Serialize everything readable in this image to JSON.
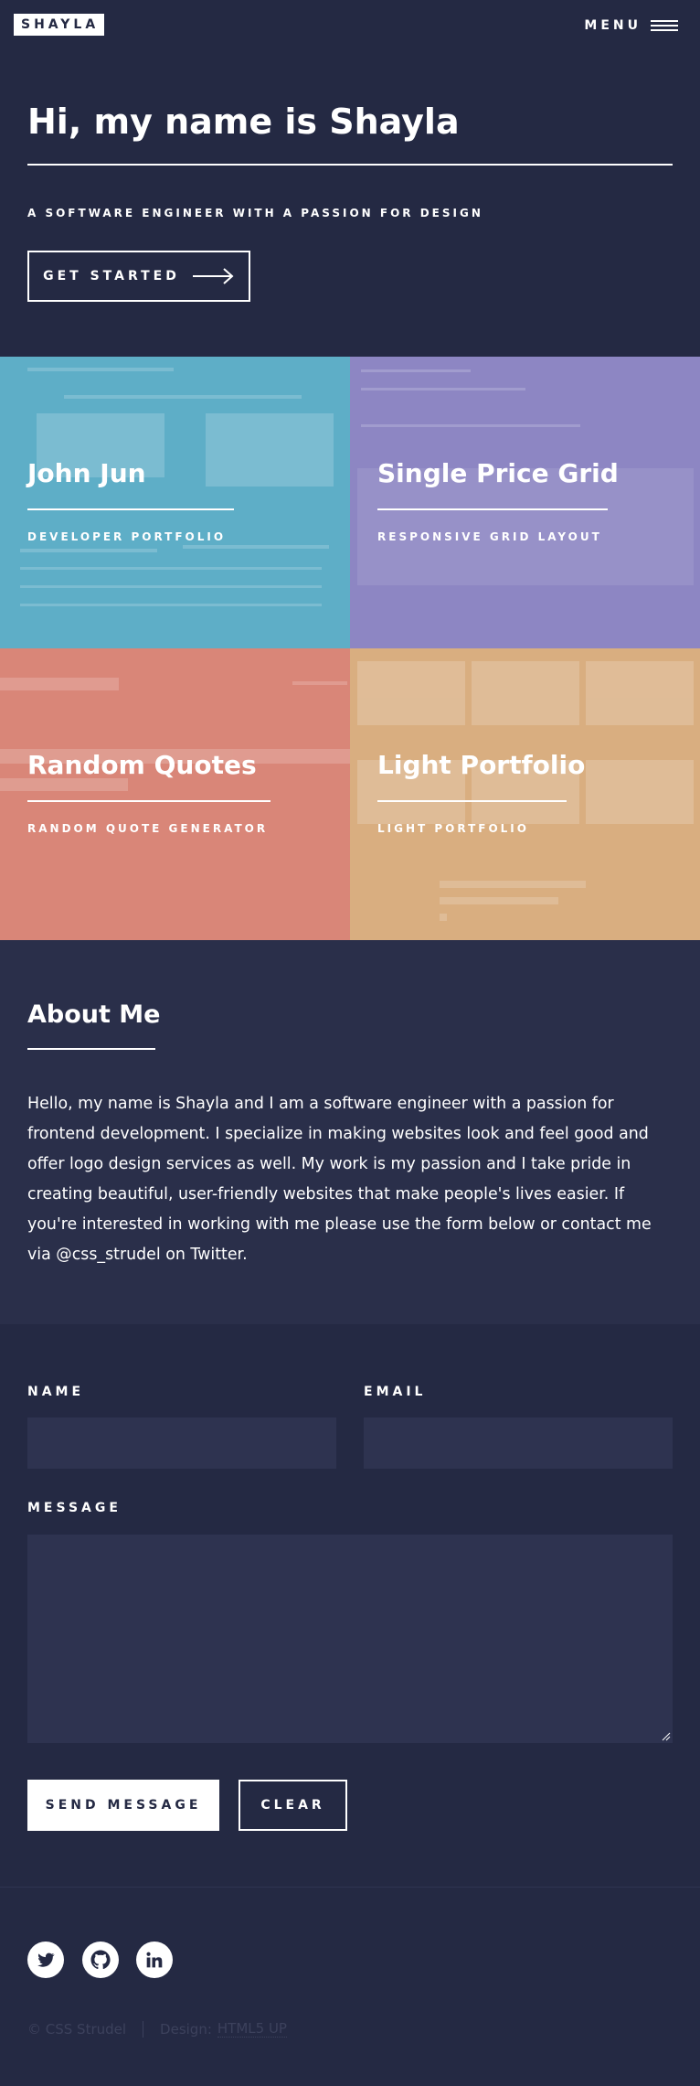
{
  "header": {
    "logo": "SHAYLA",
    "menu_label": "MENU"
  },
  "hero": {
    "title": "Hi, my name is Shayla",
    "subtitle": "A SOFTWARE ENGINEER WITH A PASSION FOR DESIGN",
    "cta_label": "GET STARTED"
  },
  "tiles": [
    {
      "title": "John Jun",
      "subtitle": "DEVELOPER PORTFOLIO",
      "color": "#5eaec7"
    },
    {
      "title": "Single Price Grid",
      "subtitle": "RESPONSIVE GRID LAYOUT",
      "color": "#8d86c3"
    },
    {
      "title": "Random Quotes",
      "subtitle": "RANDOM QUOTE GENERATOR",
      "color": "#d98678"
    },
    {
      "title": "Light Portfolio",
      "subtitle": "LIGHT PORTFOLIO",
      "color": "#d9ae80"
    }
  ],
  "about": {
    "title": "About Me",
    "text": "Hello, my name is Shayla and I am a software engineer with a passion for frontend development. I specialize in making websites look and feel good and offer logo design services as well. My work is my passion and I take pride in creating beautiful, user-friendly websites that make people's lives easier. If you're interested in working with me please use the form below or contact me via @css_strudel on Twitter."
  },
  "contact": {
    "name_label": "NAME",
    "name_value": "",
    "email_label": "EMAIL",
    "email_value": "",
    "message_label": "MESSAGE",
    "message_value": "",
    "send_label": "SEND MESSAGE",
    "clear_label": "CLEAR"
  },
  "footer": {
    "social": [
      "twitter-icon",
      "github-icon",
      "linkedin-icon"
    ],
    "copyright": "© CSS Strudel",
    "design_label": "Design:",
    "design_link": "HTML5 UP"
  },
  "colors": {
    "background": "#242943",
    "about_background": "#2a2f4a",
    "field_background": "#2e3350",
    "muted_text": "#3c415c"
  }
}
